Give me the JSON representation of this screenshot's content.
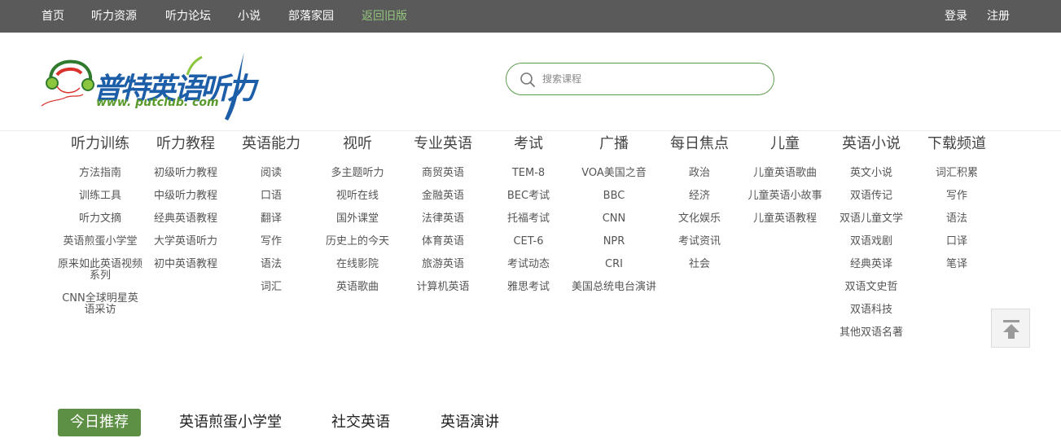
{
  "topnav": {
    "items": [
      "首页",
      "听力资源",
      "听力论坛",
      "小说",
      "部落家园",
      "返回旧版"
    ],
    "login": "登录",
    "register": "注册"
  },
  "logo": {
    "brand_text": "普特英语听力",
    "url_text": "www. putclub. com"
  },
  "search": {
    "placeholder": "搜索课程"
  },
  "nav_columns": [
    {
      "title": "听力训练",
      "items": [
        "方法指南",
        "训练工具",
        "听力文摘",
        "英语煎蛋小学堂",
        "原来如此英语视频系列",
        "CNN全球明星英语采访"
      ]
    },
    {
      "title": "听力教程",
      "items": [
        "初级听力教程",
        "中级听力教程",
        "经典英语教程",
        "大学英语听力",
        "初中英语教程"
      ]
    },
    {
      "title": "英语能力",
      "items": [
        "阅读",
        "口语",
        "翻译",
        "写作",
        "语法",
        "词汇"
      ]
    },
    {
      "title": "视听",
      "items": [
        "多主题听力",
        "视听在线",
        "国外课堂",
        "历史上的今天",
        "在线影院",
        "英语歌曲"
      ]
    },
    {
      "title": "专业英语",
      "items": [
        "商贸英语",
        "金融英语",
        "法律英语",
        "体育英语",
        "旅游英语",
        "计算机英语"
      ]
    },
    {
      "title": "考试",
      "items": [
        "TEM-8",
        "BEC考试",
        "托福考试",
        "CET-6",
        "考试动态",
        "雅思考试"
      ]
    },
    {
      "title": "广播",
      "items": [
        "VOA美国之音",
        "BBC",
        "CNN",
        "NPR",
        "CRI",
        "美国总统电台演讲"
      ]
    },
    {
      "title": "每日焦点",
      "items": [
        "政治",
        "经济",
        "文化娱乐",
        "考试资讯",
        "社会"
      ]
    },
    {
      "title": "儿童",
      "items": [
        "儿童英语歌曲",
        "儿童英语小故事",
        "儿童英语教程"
      ]
    },
    {
      "title": "英语小说",
      "items": [
        "英文小说",
        "双语传记",
        "双语儿童文学",
        "双语戏剧",
        "经典英译",
        "双语文史哲",
        "双语科技",
        "其他双语名著"
      ]
    },
    {
      "title": "下载频道",
      "items": [
        "词汇积累",
        "写作",
        "语法",
        "口译",
        "笔译"
      ]
    }
  ],
  "tabs": [
    "今日推荐",
    "英语煎蛋小学堂",
    "社交英语",
    "英语演讲"
  ],
  "colors": {
    "topbar": "#5a5a5a",
    "accent_green": "#5d8f45",
    "old_version_link": "#93c47d",
    "brand_blue": "#1d5ea8"
  }
}
